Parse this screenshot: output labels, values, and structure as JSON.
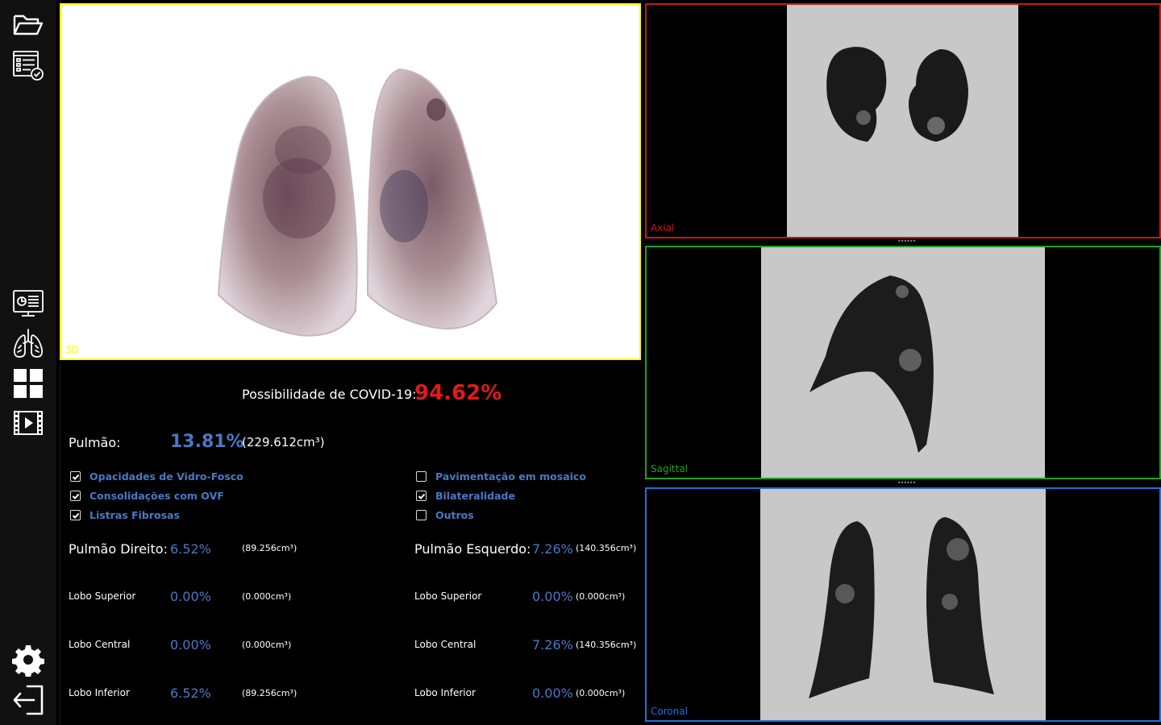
{
  "sidebar": {
    "items": [
      {
        "name": "open-folder",
        "icon": "folder-open-icon"
      },
      {
        "name": "checklist-report",
        "icon": "checklist-icon"
      },
      {
        "name": "monitor-report",
        "icon": "monitor-report-icon"
      },
      {
        "name": "lungs",
        "icon": "lungs-icon"
      },
      {
        "name": "layout-grid",
        "icon": "grid-icon"
      },
      {
        "name": "video",
        "icon": "film-play-icon"
      },
      {
        "name": "settings",
        "icon": "gear-icon"
      },
      {
        "name": "logout",
        "icon": "logout-icon"
      }
    ]
  },
  "viewports": {
    "view3d": {
      "label": "3D",
      "color": "#ffff00"
    },
    "axial": {
      "label": "Axial",
      "color": "#c81818"
    },
    "sagittal": {
      "label": "Sagittal",
      "color": "#1aa51a"
    },
    "coronal": {
      "label": "Coronal",
      "color": "#1f6fe0"
    }
  },
  "results": {
    "covid_label": "Possibilidade de COVID-19:",
    "covid_value": "94.62%",
    "lung_label": "Pulmão:",
    "lung_pct": "13.81%",
    "lung_vol": "(229.612cm³)",
    "findings_left": [
      {
        "label": "Opacidades de Vidro-Fosco",
        "checked": true
      },
      {
        "label": "Consolidações com OVF",
        "checked": true
      },
      {
        "label": "Listras Fibrosas",
        "checked": true
      }
    ],
    "findings_right": [
      {
        "label": "Pavimentação em mosaico",
        "checked": false
      },
      {
        "label": "Bilateralidade",
        "checked": true
      },
      {
        "label": "Outros",
        "checked": false
      }
    ],
    "right_lung": {
      "label": "Pulmão Direito:",
      "pct": "6.52%",
      "vol": "(89.256cm³)",
      "lobes": [
        {
          "label": "Lobo Superior",
          "pct": "0.00%",
          "vol": "(0.000cm³)"
        },
        {
          "label": "Lobo Central",
          "pct": "0.00%",
          "vol": "(0.000cm³)"
        },
        {
          "label": "Lobo Inferior",
          "pct": "6.52%",
          "vol": "(89.256cm³)"
        }
      ]
    },
    "left_lung": {
      "label": "Pulmão Esquerdo:",
      "pct": "7.26%",
      "vol": "(140.356cm³)",
      "lobes": [
        {
          "label": "Lobo Superior",
          "pct": "0.00%",
          "vol": "(0.000cm³)"
        },
        {
          "label": "Lobo Central",
          "pct": "7.26%",
          "vol": "(140.356cm³)"
        },
        {
          "label": "Lobo Inferior",
          "pct": "0.00%",
          "vol": "(0.000cm³)"
        }
      ]
    }
  },
  "colors": {
    "accent_blue": "#4a78c4",
    "covid_red": "#e01a1a"
  }
}
